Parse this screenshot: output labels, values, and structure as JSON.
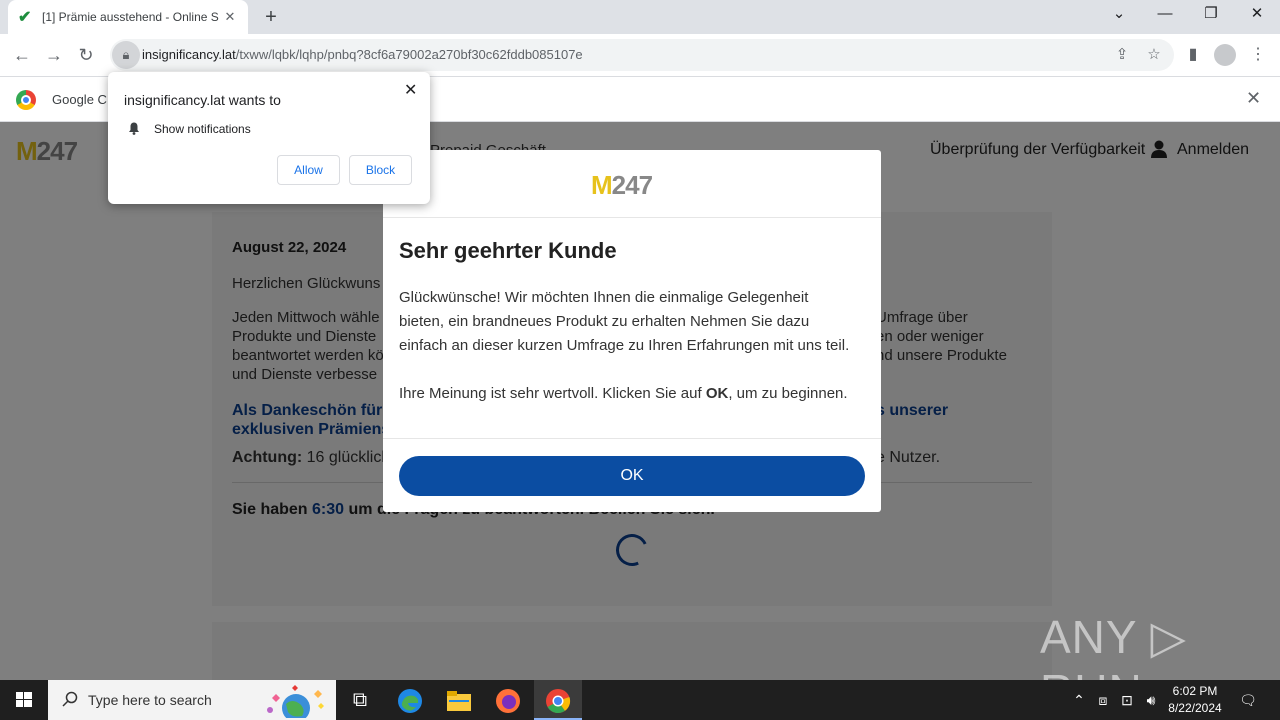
{
  "browser": {
    "tab_title": "[1] Prämie ausstehend - Online S",
    "url_domain": "insignificancy.lat",
    "url_path": "/txww/lqbk/lqhp/pnbq?8cf6a79002a270bf30c62fddb085107e",
    "infobar_text": "Google C"
  },
  "notification": {
    "title": "insignificancy.lat wants to",
    "permission": "Show notifications",
    "allow_label": "Allow",
    "block_label": "Block"
  },
  "site": {
    "logo_m": "M",
    "logo_num": "247",
    "nav_text": "Prepaid    Geschäft",
    "check_label": "Überprüfung der Verfügbarkeit",
    "login_label": "Anmelden",
    "date": "August 22, 2024",
    "greeting": "Herzlichen Glückwuns",
    "para_left_1": "Jeden Mittwoch wähle",
    "para_left_2": "Produkte und Dienste",
    "para_left_3": "beantwortet werden kö",
    "para_left_4": "und Dienste verbesse",
    "para_right_1": "Umfrage über",
    "para_right_2": "en oder weniger",
    "para_right_3": "nd unsere Produkte",
    "thanks_left_1": "Als Dankeschön für",
    "thanks_left_2": "exklusiven Prämiens",
    "thanks_right_1": "s unserer",
    "attention_label": "Achtung:",
    "attention_text": " 16 glücklich",
    "attention_right": "e Nutzer.",
    "timer_prefix": "Sie haben ",
    "timer_value": "6:30",
    "timer_suffix": " um die Fragen zu beantworten. Beeilen Sie sich."
  },
  "modal": {
    "logo_m": "M",
    "logo_num": "247",
    "title": "Sehr geehrter Kunde",
    "line1": "Glückwünsche! Wir möchten Ihnen die einmalige Gelegenheit",
    "line2": "bieten, ein brandneues Produkt zu erhalten Nehmen Sie dazu",
    "line3": "einfach an dieser kurzen Umfrage zu Ihren Erfahrungen mit uns teil.",
    "line4_pre": "Ihre Meinung ist sehr wertvoll. Klicken Sie auf ",
    "line4_bold": "OK",
    "line4_post": ", um zu beginnen.",
    "ok_label": "OK"
  },
  "watermark": "ANY ▷ RUN",
  "taskbar": {
    "search_placeholder": "Type here to search",
    "time": "6:02 PM",
    "date": "8/22/2024"
  },
  "colors": {
    "accent_blue": "#0b4da2",
    "logo_yellow": "#e7c21c"
  }
}
